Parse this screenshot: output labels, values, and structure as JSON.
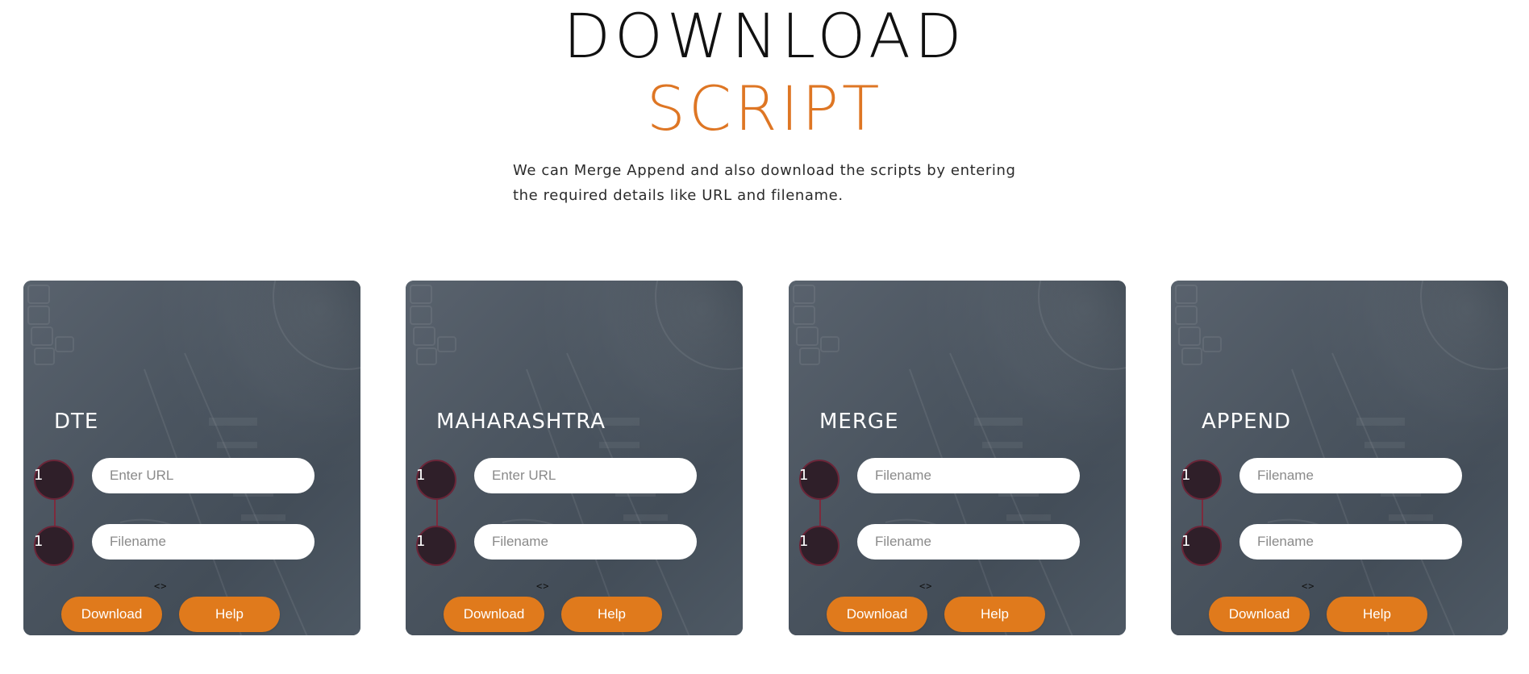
{
  "hero": {
    "title_line1": "DOWNLOAD",
    "title_line2": "SCRIPT",
    "description": "We can Merge Append and also download the scripts by entering the required details like URL and filename."
  },
  "colors": {
    "accent": "#de7624",
    "button": "#e07a1c",
    "card_bg": "#4a5561",
    "step_circle": "#2f1f29"
  },
  "cards": [
    {
      "title": "DTE",
      "step1_number": "1",
      "step2_number": "1",
      "field1_placeholder": "Enter URL",
      "field2_placeholder": "Filename",
      "code_glyph": "<>",
      "download_label": "Download",
      "help_label": "Help"
    },
    {
      "title": "MAHARASHTRA",
      "step1_number": "1",
      "step2_number": "1",
      "field1_placeholder": "Enter URL",
      "field2_placeholder": "Filename",
      "code_glyph": "<>",
      "download_label": "Download",
      "help_label": "Help"
    },
    {
      "title": "MERGE",
      "step1_number": "1",
      "step2_number": "1",
      "field1_placeholder": "Filename",
      "field2_placeholder": "Filename",
      "code_glyph": "<>",
      "download_label": "Download",
      "help_label": "Help"
    },
    {
      "title": "APPEND",
      "step1_number": "1",
      "step2_number": "1",
      "field1_placeholder": "Filename",
      "field2_placeholder": "Filename",
      "code_glyph": "<>",
      "download_label": "Download",
      "help_label": "Help"
    }
  ]
}
